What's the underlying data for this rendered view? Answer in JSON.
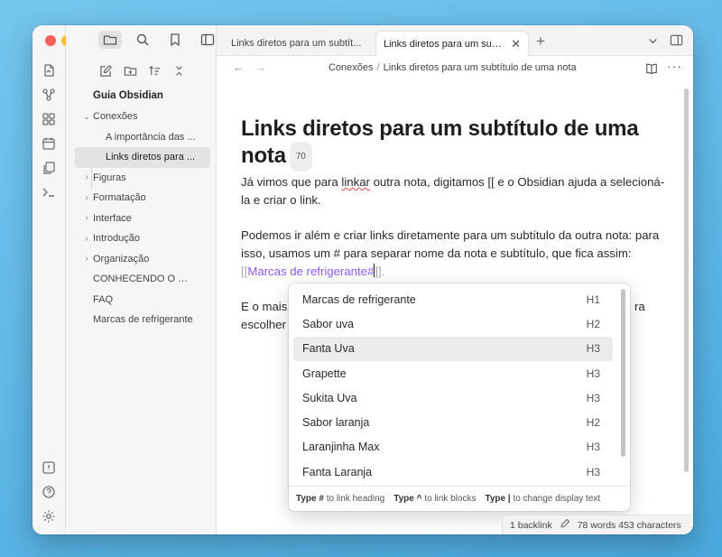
{
  "tabs": [
    {
      "label": "Links diretos para um subtít...",
      "active": false
    },
    {
      "label": "Links diretos para um sub...",
      "active": true
    }
  ],
  "sidebar": {
    "vault_title": "Guia Obsidian",
    "items": [
      {
        "label": "Conexões",
        "kind": "folder-open"
      },
      {
        "label": "A importância das ...",
        "kind": "child"
      },
      {
        "label": "Links diretos para ...",
        "kind": "child-selected"
      },
      {
        "label": "Figuras",
        "kind": "folder"
      },
      {
        "label": "Formatação",
        "kind": "folder"
      },
      {
        "label": "Interface",
        "kind": "folder"
      },
      {
        "label": "Introdução",
        "kind": "folder"
      },
      {
        "label": "Organização",
        "kind": "folder"
      },
      {
        "label": "CONHECENDO O OB...",
        "kind": "file"
      },
      {
        "label": "FAQ",
        "kind": "file"
      },
      {
        "label": "Marcas de refrigerante",
        "kind": "file"
      }
    ]
  },
  "breadcrumb": {
    "folder": "Conexões",
    "separator": "/",
    "note": "Links diretos para um subtítulo de uma nota"
  },
  "note": {
    "title": "Links diretos para um subtítulo de uma nota",
    "title_count": "70",
    "p1_before": "Já vimos que para ",
    "p1_word": "linkar",
    "p1_after": " outra nota, digitamos [[ e o Obsidian ajuda a selecioná-la e criar o link.",
    "p2_text": "Podemos ir além e criar links diretamente para um subtítulo da outra nota: para isso, usamos um # para separar nome da nota e subtítulo, que fica assim: ",
    "p2_open": "[[",
    "p2_link": "Marcas de refrigerante#",
    "p2_close": "]].",
    "p3_start": "E o mais",
    "p3_end": "ra",
    "p3_line2": "escolher"
  },
  "suggest": {
    "items": [
      {
        "label": "Marcas de refrigerante",
        "level": "H1",
        "active": false
      },
      {
        "label": "Sabor uva",
        "level": "H2",
        "active": false
      },
      {
        "label": "Fanta Uva",
        "level": "H3",
        "active": true
      },
      {
        "label": "Grapette",
        "level": "H3",
        "active": false
      },
      {
        "label": "Sukita Uva",
        "level": "H3",
        "active": false
      },
      {
        "label": "Sabor laranja",
        "level": "H2",
        "active": false
      },
      {
        "label": "Laranjinha Max",
        "level": "H3",
        "active": false
      },
      {
        "label": "Fanta Laranja",
        "level": "H3",
        "active": false
      }
    ],
    "footer": {
      "k1": "Type #",
      "t1": "to link heading",
      "k2": "Type ^",
      "t2": "to link blocks",
      "k3": "Type |",
      "t3": "to change display text"
    }
  },
  "status": {
    "backlinks": "1 backlink",
    "counts": "78 words 453 characters"
  },
  "colors": {
    "accent_link": "#8a5cf5",
    "traffic_red": "#ff5f57",
    "traffic_yellow": "#febc2e",
    "traffic_green": "#28c840"
  }
}
